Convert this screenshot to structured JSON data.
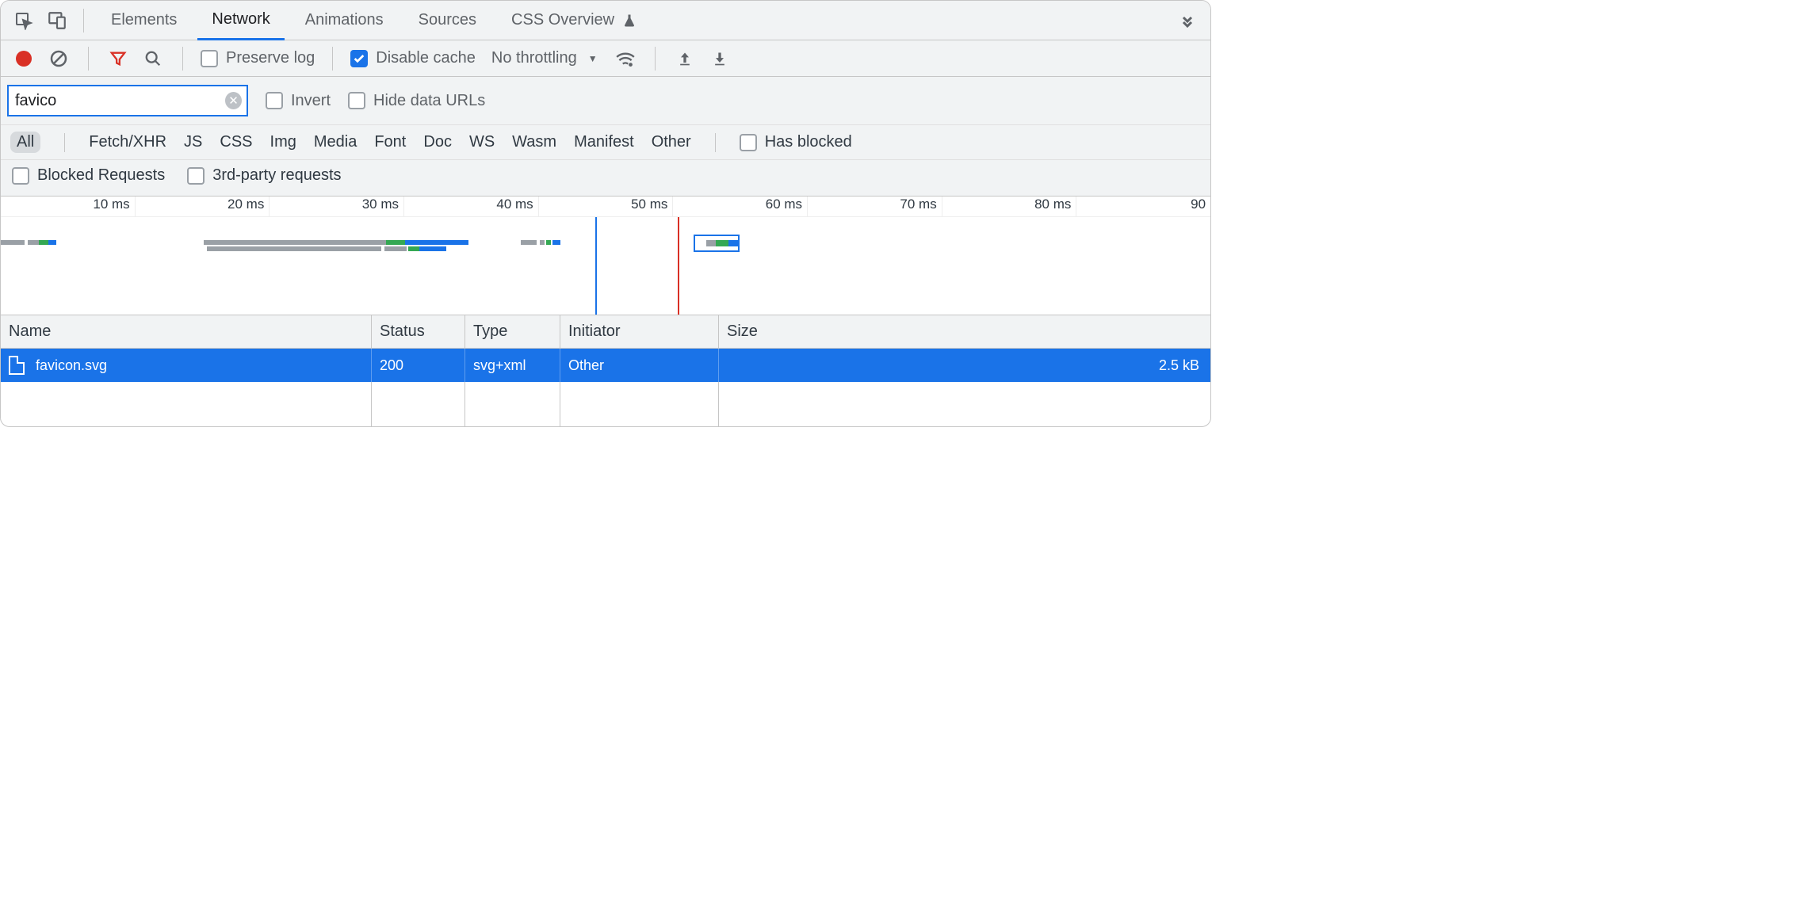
{
  "tabs": {
    "elements": "Elements",
    "network": "Network",
    "animations": "Animations",
    "sources": "Sources",
    "css_overview": "CSS Overview"
  },
  "toolbar": {
    "preserve_log": "Preserve log",
    "disable_cache": "Disable cache",
    "throttling": "No throttling"
  },
  "filter": {
    "value": "favico",
    "invert": "Invert",
    "hide_data_urls": "Hide data URLs"
  },
  "types": {
    "all": "All",
    "fetch_xhr": "Fetch/XHR",
    "js": "JS",
    "css": "CSS",
    "img": "Img",
    "media": "Media",
    "font": "Font",
    "doc": "Doc",
    "ws": "WS",
    "wasm": "Wasm",
    "manifest": "Manifest",
    "other": "Other",
    "has_blocked": "Has blocked"
  },
  "types2": {
    "blocked_requests": "Blocked Requests",
    "third_party": "3rd-party requests"
  },
  "overview": {
    "ticks": [
      "10 ms",
      "20 ms",
      "30 ms",
      "40 ms",
      "50 ms",
      "60 ms",
      "70 ms",
      "80 ms",
      "90 "
    ]
  },
  "table": {
    "headers": {
      "name": "Name",
      "status": "Status",
      "type": "Type",
      "initiator": "Initiator",
      "size": "Size"
    },
    "rows": [
      {
        "name": "favicon.svg",
        "status": "200",
        "type": "svg+xml",
        "initiator": "Other",
        "size": "2.5 kB"
      }
    ]
  }
}
